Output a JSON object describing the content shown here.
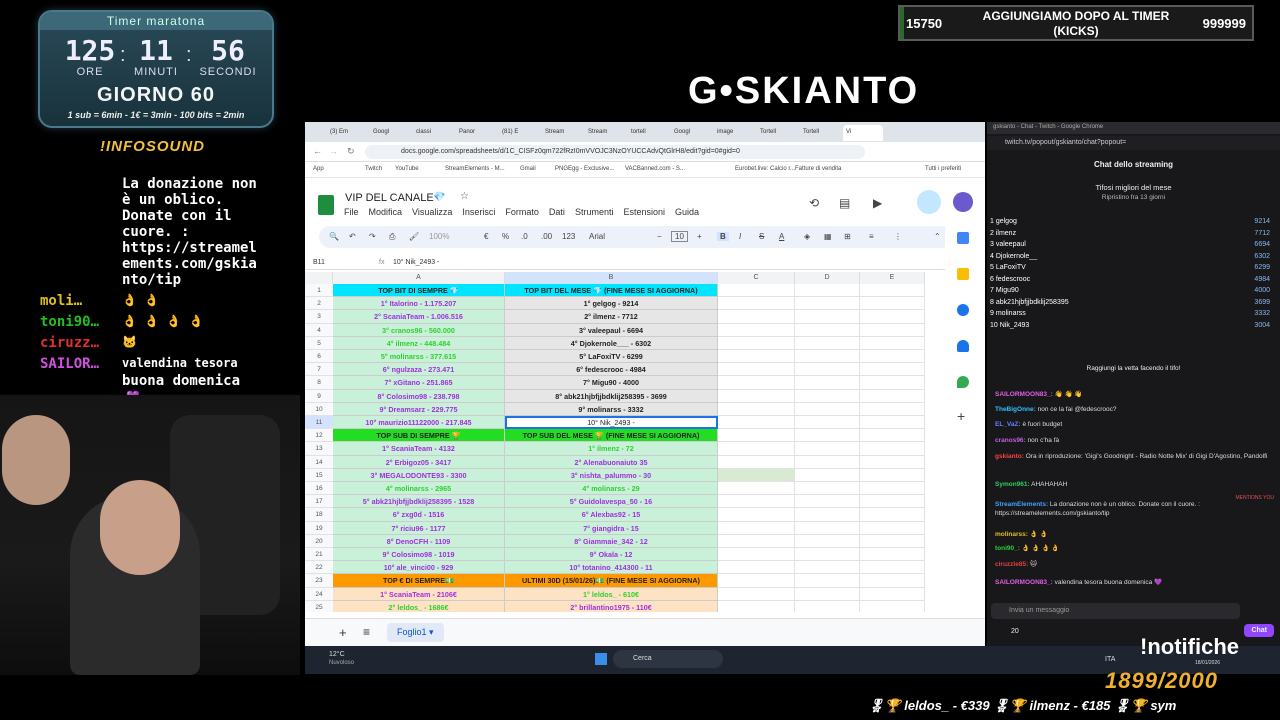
{
  "timer": {
    "title": "Timer maratona",
    "hours": "125",
    "minutes": "11",
    "seconds": "56",
    "hours_label": "ORE",
    "minutes_label": "MINUTI",
    "seconds_label": "SECONDI",
    "day": "GIORNO 60",
    "rates": "1 sub = 6min - 1€ = 3min - 100 bits = 2min"
  },
  "infosound": "!INFOSOUND",
  "left_chat": {
    "donation_text": [
      "è un oblico.",
      "Donate con il",
      "cuore. :",
      "https://streamel",
      "ements.com/gskia",
      "nto/tip"
    ],
    "top_line": "La donazione non",
    "rows": [
      {
        "user": "moli…",
        "color": "#e0c020",
        "msg": "👌 👌"
      },
      {
        "user": "toni90…",
        "color": "#20c020",
        "msg": "👌 👌 👌 👌"
      },
      {
        "user": "ciruzz…",
        "color": "#e03030",
        "msg": "🐱"
      },
      {
        "user": "SAILOR…",
        "color": "#d050e0",
        "msg": "valendina tesora"
      }
    ],
    "last_line": "buona domenica",
    "heart": "💜"
  },
  "logo": "G•SKIANTO",
  "goal": {
    "low": "15750",
    "text": "AGGIUNGIAMO DOPO AL TIMER (KICKS)",
    "high": "999999",
    "fill": 0.01,
    "color": "#2a6a2a"
  },
  "browser": {
    "tabs": [
      "(3) Em",
      "Googl",
      "classi",
      "Panor",
      "(81) E",
      "Stream",
      "Stream",
      "tortell",
      "Googl",
      "image",
      "Tortell",
      "Tortell",
      "Vi"
    ],
    "url": "docs.google.com/spreadsheets/d/1C_CISFz0qm722fRzI0mVVOJC3NzOYUCCAdvQtGlrH8/edit?gid=0#gid=0",
    "bookmarks": [
      "App",
      "Twitch",
      "YouTube",
      "StreamElements - M...",
      "Gmail",
      "PNGEgg - Exclusive...",
      "VACBanned.com - S...",
      "Eurobet.live: Calcio r...",
      "Fatture di vendita",
      "Tutti i preferiti"
    ],
    "doc_title": "VIP DEL CANALE",
    "menu": [
      "File",
      "Modifica",
      "Visualizza",
      "Inserisci",
      "Formato",
      "Dati",
      "Strumenti",
      "Estensioni",
      "Guida"
    ],
    "toolbar": {
      "zoom": "100%",
      "currency": "€",
      "percent": "%",
      "dec1": ".0",
      "dec2": ".00",
      "format": "123",
      "font": "Arial",
      "size": "10"
    },
    "cell_ref": "B11",
    "formula": "10° Nik_2493 -",
    "columns": [
      "A",
      "B",
      "C",
      "D",
      "E"
    ],
    "rows": [
      {
        "n": "1",
        "a": "TOP BIT DI SEMPRE 💎",
        "b": "TOP BIT DEL MESE 💎 (FINE MESE SI AGGIORNA)",
        "abg": "#00e5ff",
        "bbg": "#00e5ff",
        "ac": "#222",
        "bc": "#222"
      },
      {
        "n": "2",
        "a": "1° Italorino - 1.175.207",
        "b": "1° gelgog - 9214",
        "abg": "#c9f0d8",
        "bbg": "#e6e6e6",
        "ac": "#a030e0",
        "bc": "#222"
      },
      {
        "n": "3",
        "a": "2° ScaniaTeam - 1.006.516",
        "b": "2° ilmenz - 7712",
        "abg": "#c9f0d8",
        "bbg": "#e6e6e6",
        "ac": "#a030e0",
        "bc": "#222"
      },
      {
        "n": "4",
        "a": "3° cranos96 - 560.000",
        "b": "3° valeepaul - 6694",
        "abg": "#c9f0d8",
        "bbg": "#e6e6e6",
        "ac": "#30d030",
        "bc": "#222"
      },
      {
        "n": "5",
        "a": "4° ilmenz - 448.484",
        "b": "4° Djokernole___ - 6302",
        "abg": "#c9f0d8",
        "bbg": "#e6e6e6",
        "ac": "#30d030",
        "bc": "#222"
      },
      {
        "n": "6",
        "a": "5° molinarss - 377.615",
        "b": "5° LaFoxiTV - 6299",
        "abg": "#c9f0d8",
        "bbg": "#e6e6e6",
        "ac": "#30d030",
        "bc": "#222"
      },
      {
        "n": "7",
        "a": "6° ngulzaza - 273.471",
        "b": "6° fedescrooc - 4984",
        "abg": "#c9f0d8",
        "bbg": "#e6e6e6",
        "ac": "#a030e0",
        "bc": "#222"
      },
      {
        "n": "8",
        "a": "7° xGitano - 251.865",
        "b": "7° Migu90 - 4000",
        "abg": "#c9f0d8",
        "bbg": "#e6e6e6",
        "ac": "#a030e0",
        "bc": "#222"
      },
      {
        "n": "9",
        "a": "8° Colosimo98 - 238.798",
        "b": "8° abk21hjbfjjbdklij258395 - 3699",
        "abg": "#c9f0d8",
        "bbg": "#e6e6e6",
        "ac": "#a030e0",
        "bc": "#222"
      },
      {
        "n": "10",
        "a": "9° Dreamsarz - 229.775",
        "b": "9° molinarss - 3332",
        "abg": "#c9f0d8",
        "bbg": "#e6e6e6",
        "ac": "#a030e0",
        "bc": "#222"
      },
      {
        "n": "11",
        "a": "10° maurizio11122000 - 217.845",
        "b": "10° Nik_2493 -",
        "abg": "#c9f0d8",
        "bbg": "#ffffff",
        "ac": "#a030e0",
        "bc": "#222"
      },
      {
        "n": "12",
        "a": "TOP SUB DI SEMPRE 🏆",
        "b": "TOP SUB DEL MESE 🏆 (FINE MESE SI AGGIORNA)",
        "abg": "#22dd22",
        "bbg": "#22dd22",
        "ac": "#222",
        "bc": "#222"
      },
      {
        "n": "13",
        "a": "1° ScaniaTeam - 4132",
        "b": "1° ilmenz - 72",
        "abg": "#c9f0d8",
        "bbg": "#c9f0d8",
        "ac": "#a030e0",
        "bc": "#30d030"
      },
      {
        "n": "14",
        "a": "2° Erbigoz05 - 3417",
        "b": "2° Alenabuonaiuto 35",
        "abg": "#c9f0d8",
        "bbg": "#c9f0d8",
        "ac": "#a030e0",
        "bc": "#a030e0"
      },
      {
        "n": "15",
        "a": "3° MEGALODONTE93 - 3300",
        "b": "3° nishta_palummo - 30",
        "abg": "#c9f0d8",
        "bbg": "#c9f0d8",
        "ac": "#a030e0",
        "bc": "#a030e0"
      },
      {
        "n": "16",
        "a": "4° molinarss - 2965",
        "b": "4° molinarss - 29",
        "abg": "#c9f0d8",
        "bbg": "#c9f0d8",
        "ac": "#30d030",
        "bc": "#30d030"
      },
      {
        "n": "17",
        "a": "5° abk21hjbfjjbdklij258395 - 1528",
        "b": "5° Guidolavespa_50 - 16",
        "abg": "#c9f0d8",
        "bbg": "#c9f0d8",
        "ac": "#a030e0",
        "bc": "#a030e0"
      },
      {
        "n": "18",
        "a": "6° zxg0d - 1516",
        "b": "6° Alexbas92 - 15",
        "abg": "#c9f0d8",
        "bbg": "#c9f0d8",
        "ac": "#a030e0",
        "bc": "#a030e0"
      },
      {
        "n": "19",
        "a": "7° riciu96 - 1177",
        "b": "7° giangidra - 15",
        "abg": "#c9f0d8",
        "bbg": "#c9f0d8",
        "ac": "#a030e0",
        "bc": "#a030e0"
      },
      {
        "n": "20",
        "a": "8° DenoCFH - 1109",
        "b": "8° Giammaie_342 - 12",
        "abg": "#c9f0d8",
        "bbg": "#c9f0d8",
        "ac": "#a030e0",
        "bc": "#a030e0"
      },
      {
        "n": "21",
        "a": "9° Colosimo98 - 1019",
        "b": "9° Okala - 12",
        "abg": "#c9f0d8",
        "bbg": "#c9f0d8",
        "ac": "#a030e0",
        "bc": "#a030e0"
      },
      {
        "n": "22",
        "a": "10° ale_vinci00 - 929",
        "b": "10° totanino_414300 - 11",
        "abg": "#c9f0d8",
        "bbg": "#c9f0d8",
        "ac": "#a030e0",
        "bc": "#a030e0"
      },
      {
        "n": "23",
        "a": "TOP € DI SEMPRE💵",
        "b": "ULTIMI 30D (15/01/26)💵 (FINE MESE SI AGGIORNA)",
        "abg": "#ff9900",
        "bbg": "#ff9900",
        "ac": "#222",
        "bc": "#222"
      },
      {
        "n": "24",
        "a": "1° ScaniaTeam - 2106€",
        "b": "1° leldos_ - 610€",
        "abg": "#fde2c4",
        "bbg": "#fde2c4",
        "ac": "#a030e0",
        "bc": "#30d030"
      },
      {
        "n": "25",
        "a": "2° leldos_ - 1686€",
        "b": "2° brillantino1975 - 110€",
        "abg": "#fde2c4",
        "bbg": "#fde2c4",
        "ac": "#30d030",
        "bc": "#a030e0"
      }
    ],
    "sheet_tab": "Foglio1"
  },
  "twitch": {
    "window_title": "gskianto - Chat - Twitch - Google Chrome",
    "address": "twitch.tv/popout/gskianto/chat?popout=",
    "header": "Chat dello streaming",
    "leaders_title": "Tifosi migliori del mese",
    "leaders_sub": "Ripristino fra 13 giorni",
    "leaders": [
      {
        "name": "gelgog",
        "value": "9214"
      },
      {
        "name": "ilmenz",
        "value": "7712"
      },
      {
        "name": "valeepaul",
        "value": "6694"
      },
      {
        "name": "Djokernole__",
        "value": "6302"
      },
      {
        "name": "LaFoxiTV",
        "value": "6299"
      },
      {
        "name": "fedescrooc",
        "value": "4984"
      },
      {
        "name": "Migu90",
        "value": "4000"
      },
      {
        "name": "abk21hjbfjjbdklij258395",
        "value": "3699"
      },
      {
        "name": "molinarss",
        "value": "3332"
      },
      {
        "name": "Nik_2493",
        "value": "3004"
      }
    ],
    "cta": "Raggiungi la vetta facendo il tifo!",
    "messages": [
      {
        "user": "SAILORMOON83_:",
        "color": "#e060e0",
        "text": "👋 👋 👋"
      },
      {
        "user": "TheBigOnne:",
        "color": "#30c0ff",
        "text": "non ce la fai @fedescrooc?"
      },
      {
        "user": "EL_VaZ:",
        "color": "#6080ff",
        "text": "è fuori budget"
      },
      {
        "user": "cranos96:",
        "color": "#c060e0",
        "text": "non c'ha fà"
      },
      {
        "user": "gskianto:",
        "color": "#ff4040",
        "text": "Ora in riproduzione: 'Gigi's Goodnight - Radio Notte Mix' di Gigi D'Agostino, Pandolfi"
      },
      {
        "user": "Symon961:",
        "color": "#30d060",
        "text": "AHAHAHAH"
      },
      {
        "user": "StreamElements:",
        "color": "#40a0ff",
        "text": "La donazione non è un oblico. Donate con il cuore. : https://streamelements.com/gskianto/tip"
      },
      {
        "user": "molinarss:",
        "color": "#e0c020",
        "text": "👌 👌"
      },
      {
        "user": "toni90_:",
        "color": "#30d030",
        "text": "👌 👌 👌 👌"
      },
      {
        "user": "ciruzzle85:",
        "color": "#e04040",
        "text": "🐱"
      },
      {
        "user": "SAILORMOON83_:",
        "color": "#e060e0",
        "text": "valendina tesora buona domenica 💜"
      }
    ],
    "mention_tag": "MENTIONS YOU",
    "input_placeholder": "Invia un messaggio",
    "points": "20",
    "chat_button": "Chat"
  },
  "taskbar": {
    "weather_temp": "12°C",
    "weather_desc": "Nuvoloso",
    "search": "Cerca",
    "lang": "ITA",
    "date": "18/01/2026"
  },
  "notifiche": "!notifiche",
  "counter": "1899/2000",
  "ticker": "🎖🏆 leldos_ - €339   🎖🏆 ilmenz - €185   🎖🏆 sym"
}
